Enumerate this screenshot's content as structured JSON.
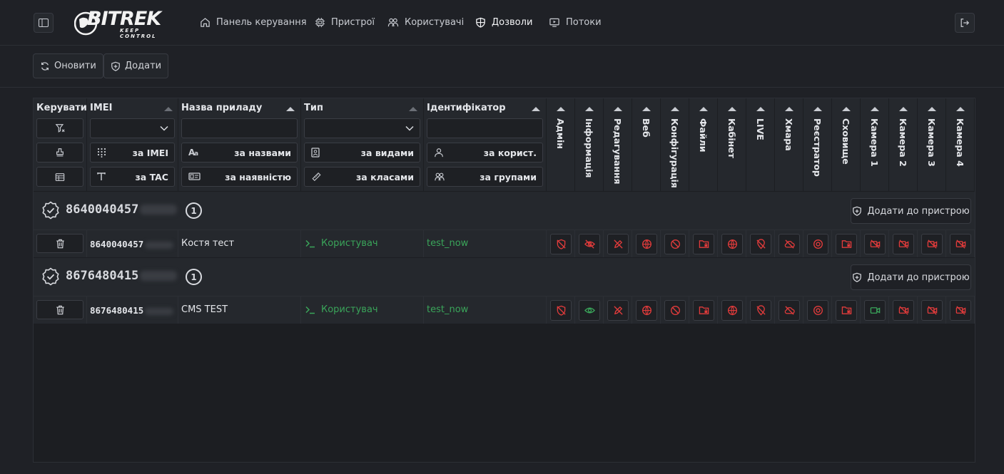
{
  "brand": {
    "name": "BITREK",
    "tagline": "KEEP CONTROL"
  },
  "nav": [
    {
      "label": "Панель керування",
      "icon": "home-icon"
    },
    {
      "label": "Пристрої",
      "icon": "chip-icon"
    },
    {
      "label": "Користувачі",
      "icon": "users-icon"
    },
    {
      "label": "Дозволи",
      "icon": "shield-icon",
      "active": true
    },
    {
      "label": "Потоки",
      "icon": "stream-icon"
    }
  ],
  "toolbar": {
    "refresh": "Оновити",
    "add": "Додати"
  },
  "headers": {
    "manage": "Керувати",
    "imei": "IMEI",
    "device_name": "Назва приладу",
    "type": "Тип",
    "identifier": "Ідентифікатор"
  },
  "filters": {
    "by_imei": "за IMEI",
    "by_tac": "за TAC",
    "by_name": "за назвами",
    "by_presence": "за наявністю",
    "by_kinds": "за видами",
    "by_classes": "за класами",
    "by_user": "за корист.",
    "by_groups": "за групами"
  },
  "permissions": [
    "Адмін",
    "Інформація",
    "Редагування",
    "Веб",
    "Конфігурація",
    "Файли",
    "Кабінет",
    "LIVE",
    "Хмара",
    "Реєстратор",
    "Сховище",
    "Камера 1",
    "Камера 2",
    "Камера 3",
    "Камера 4"
  ],
  "groups": [
    {
      "imei_prefix": "8640040457",
      "count": "1",
      "add_label": "Додати до пристрою",
      "row": {
        "imei_prefix": "8640040457",
        "name": "Костя тест",
        "type": "Користувач",
        "identifier": "test_now",
        "perm_states": [
          false,
          false,
          false,
          false,
          false,
          false,
          false,
          false,
          false,
          false,
          false,
          false,
          false,
          false,
          false
        ]
      }
    },
    {
      "imei_prefix": "8676480415",
      "count": "1",
      "add_label": "Додати до пристрою",
      "row": {
        "imei_prefix": "8676480415",
        "name": "CMS TEST",
        "type": "Користувач",
        "identifier": "test_now",
        "perm_states": [
          false,
          true,
          false,
          false,
          false,
          false,
          false,
          false,
          false,
          false,
          false,
          true,
          false,
          false,
          false
        ]
      }
    }
  ],
  "colors": {
    "denied": "#e23b3b",
    "granted": "#3aa55a",
    "accent_green": "#3aa55a"
  },
  "perm_icons": [
    "shield-off-icon",
    "eye-icon",
    "pencil-off-icon",
    "globe-icon",
    "ban-icon",
    "folder-lock-icon",
    "globe-icon",
    "pin-off-icon",
    "cloud-off-icon",
    "record-icon",
    "folder-lock-icon",
    "camera-icon",
    "camera-icon",
    "camera-icon",
    "camera-icon"
  ]
}
